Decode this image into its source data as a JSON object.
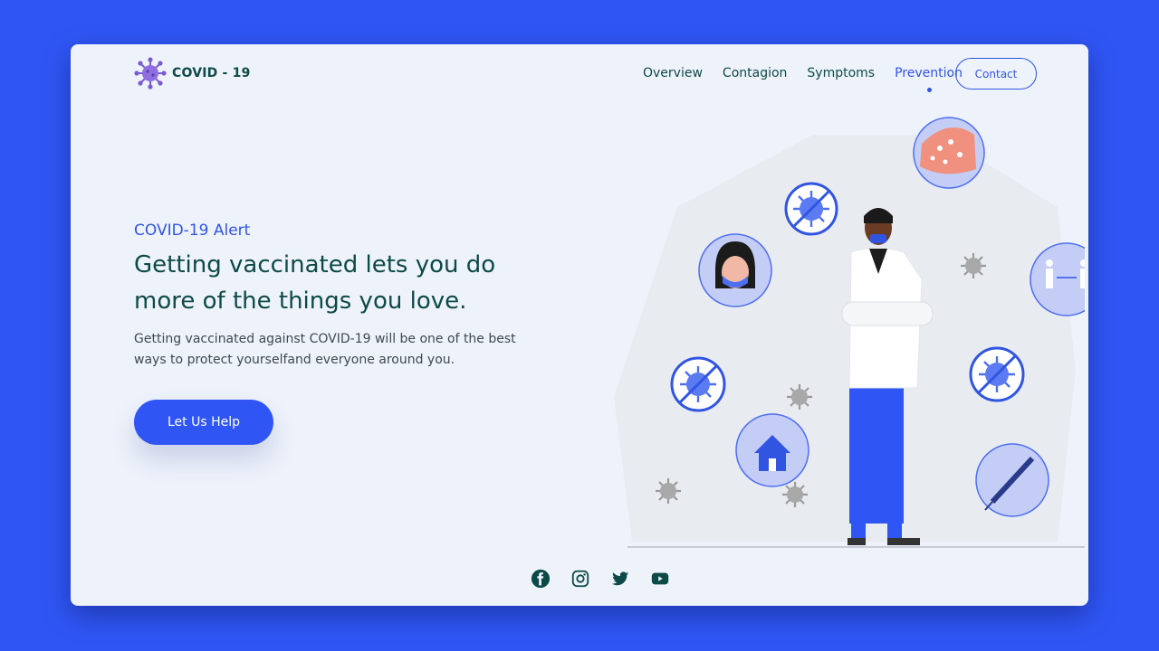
{
  "brand": {
    "name": "COVID - 19",
    "logo_icon": "virus-icon"
  },
  "nav": {
    "items": [
      {
        "label": "Overview",
        "active": false
      },
      {
        "label": "Contagion",
        "active": false
      },
      {
        "label": "Symptoms",
        "active": false
      },
      {
        "label": "Prevention",
        "active": true
      }
    ],
    "contact_label": "Contact"
  },
  "hero": {
    "alert": "COVID-19 Alert",
    "headline": "Getting vaccinated lets you do more of the things you love.",
    "description": "Getting vaccinated against COVID-19 will be one of the best ways to protect yourselfand everyone around you.",
    "cta_label": "Let Us Help"
  },
  "social": [
    "facebook-icon",
    "instagram-icon",
    "twitter-icon",
    "youtube-icon"
  ],
  "colors": {
    "accent": "#2f56f5",
    "text_dark": "#0d4a47",
    "card_bg": "#eef2fb",
    "bubble": "#c4cdf6"
  }
}
